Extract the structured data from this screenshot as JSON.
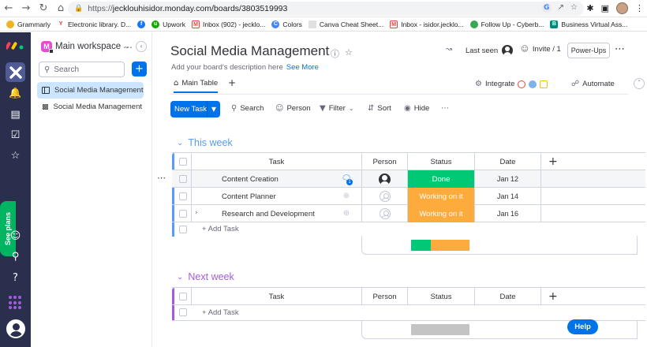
{
  "browser": {
    "url_host": "https://",
    "url_rest": "jecklouhisidor.monday.com/boards/3803519993"
  },
  "bookmarks": [
    {
      "label": "Grammarly",
      "color": "#f0b323"
    },
    {
      "label": "Electronic library. D...",
      "color": "#e53935"
    },
    {
      "label": "",
      "color": "#1877f2"
    },
    {
      "label": "Upwork",
      "color": "#14a800"
    },
    {
      "label": "Inbox (902) - jecklo...",
      "color": "#ea4335"
    },
    {
      "label": "Colors",
      "color": "#4285f4"
    },
    {
      "label": "Canva Cheat Sheet...",
      "color": "#00c4cc"
    },
    {
      "label": "Inbox - isidor.jecklo...",
      "color": "#ea4335"
    },
    {
      "label": "Follow Up - Cyberb...",
      "color": "#34a853"
    },
    {
      "label": "Business Virtual Ass...",
      "color": "#00897b"
    }
  ],
  "rail": {
    "see_plans": "See plans"
  },
  "workspace": {
    "badge": "M",
    "name": "Main workspace",
    "search_placeholder": "Search",
    "items": [
      {
        "label": "Social Media Management"
      },
      {
        "label": "Social Media Management ..."
      }
    ]
  },
  "board": {
    "title": "Social Media Management",
    "description": "Add your board's description here",
    "see_more": "See More",
    "last_seen": "Last seen",
    "invite": "Invite / 1",
    "powerups": "Power-Ups",
    "tab_main": "Main Table",
    "integrate": "Integrate",
    "automate": "Automate",
    "toolbar": {
      "new_task": "New Task",
      "search": "Search",
      "person": "Person",
      "filter": "Filter",
      "sort": "Sort",
      "hide": "Hide"
    }
  },
  "columns": {
    "task": "Task",
    "person": "Person",
    "status": "Status",
    "date": "Date"
  },
  "groups": [
    {
      "title": "This week",
      "color": "#579bfc",
      "rows": [
        {
          "task": "Content Creation",
          "status": "Done",
          "status_color": "#00c875",
          "date": "Jan 12"
        },
        {
          "task": "Content Planner",
          "status": "Working on it",
          "status_color": "#fdab3d",
          "date": "Jan 14"
        },
        {
          "task": "Research and Development",
          "status": "Working on it",
          "status_color": "#fdab3d",
          "date": "Jan 16"
        }
      ],
      "add_task": "+ Add Task",
      "summary": {
        "done_fraction": 0.333,
        "working_fraction": 0.667
      }
    },
    {
      "title": "Next week",
      "color": "#a25ddc",
      "rows": [],
      "add_task": "+ Add Task"
    }
  ],
  "help": "Help"
}
